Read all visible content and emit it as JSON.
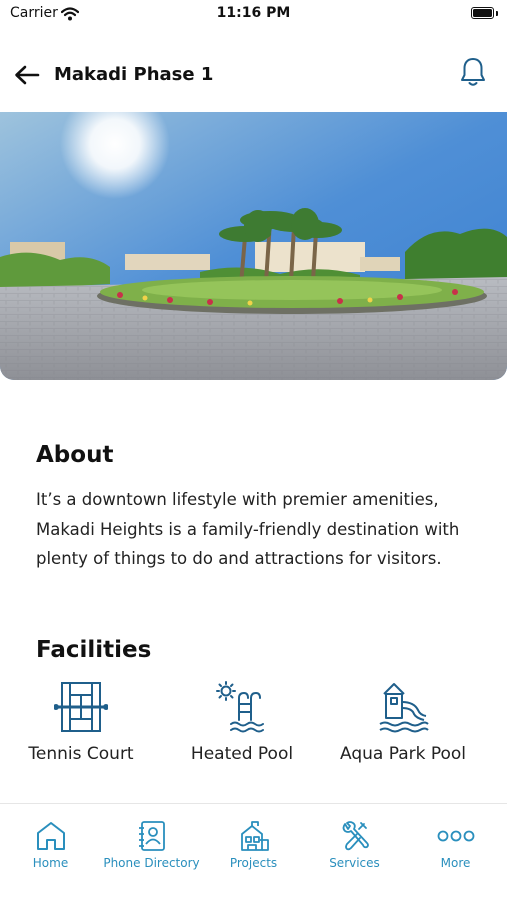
{
  "status_bar": {
    "carrier": "Carrier",
    "time": "11:16 PM"
  },
  "header": {
    "title": "Makadi Phase 1"
  },
  "about": {
    "heading": "About",
    "text": "It’s a downtown lifestyle with premier amenities, Makadi Heights is a family-friendly destination with plenty of things to do and attractions for visitors."
  },
  "facilities": {
    "heading": "Facilities",
    "items": [
      {
        "label": "Tennis Court",
        "icon": "tennis-court-icon"
      },
      {
        "label": "Heated Pool",
        "icon": "heated-pool-icon"
      },
      {
        "label": "Aqua Park Pool",
        "icon": "aqua-park-icon"
      }
    ]
  },
  "tabs": [
    {
      "label": "Home",
      "icon": "home-icon"
    },
    {
      "label": "Phone Directory",
      "icon": "phone-directory-icon"
    },
    {
      "label": "Projects",
      "icon": "projects-icon"
    },
    {
      "label": "Services",
      "icon": "services-icon"
    },
    {
      "label": "More",
      "icon": "more-icon"
    }
  ],
  "colors": {
    "accent": "#2a8fbd",
    "facility_icon": "#1f5f8b",
    "text": "#111111"
  }
}
